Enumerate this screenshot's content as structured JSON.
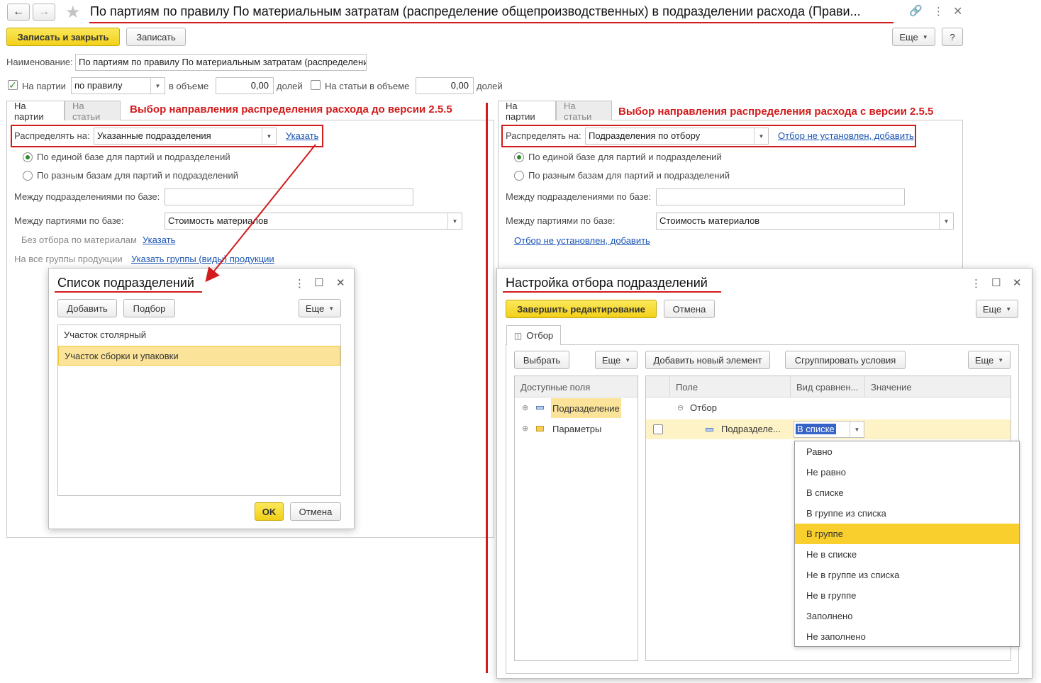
{
  "window": {
    "title": "По партиям по правилу По материальным затратам (распределение общепроизводственных) в подразделении расхода (Прави...",
    "save_close": "Записать и закрыть",
    "save": "Записать",
    "more": "Еще",
    "help": "?"
  },
  "form": {
    "name_label": "Наименование:",
    "name_value": "По партиям по правилу По материальным затратам (распределени",
    "by_batches_label": "На партии",
    "rule_value": "по правилу",
    "volume_label": "в объеме",
    "volume_value": "0,00",
    "shares_label": "долей",
    "by_items_label": "На статьи в объеме",
    "items_volume_value": "0,00",
    "items_shares_label": "долей"
  },
  "left": {
    "tab_batches": "На партии",
    "tab_items": "На статьи",
    "annotation": "Выбор направления распределения расхода до версии 2.5.5",
    "distribute_label": "Распределять на:",
    "distribute_value": "Указанные подразделения",
    "specify_link": "Указать",
    "radio1": "По единой базе для партий и подразделений",
    "radio2": "По разным базам для партий и подразделений",
    "between_depts_label": "Между подразделениями по базе:",
    "between_batches_label": "Между партиями по базе:",
    "between_batches_value": "Стоимость материалов",
    "no_filter_label": "Без отбора по материалам",
    "no_filter_link": "Указать",
    "all_groups_label": "На все группы продукции",
    "all_groups_link": "Указать группы (виды) продукции"
  },
  "dept_dialog": {
    "title": "Список подразделений",
    "add": "Добавить",
    "pick": "Подбор",
    "more": "Еще",
    "items": [
      "Участок столярный",
      "Участок сборки и упаковки"
    ],
    "ok": "OK",
    "cancel": "Отмена"
  },
  "right": {
    "tab_batches": "На партии",
    "tab_items": "На статьи",
    "annotation": "Выбор направления распределения расхода с версии 2.5.5",
    "distribute_label": "Распределять на:",
    "distribute_value": "Подразделения по отбору",
    "filter_link": "Отбор не установлен, добавить",
    "radio1": "По единой базе для партий и подразделений",
    "radio2": "По разным базам для партий и подразделений",
    "between_depts_label": "Между подразделениями по базе:",
    "between_batches_label": "Между партиями по базе:",
    "between_batches_value": "Стоимость материалов",
    "filter_link2": "Отбор не установлен, добавить"
  },
  "filter_dialog": {
    "title": "Настройка отбора подразделений",
    "finish": "Завершить редактирование",
    "cancel": "Отмена",
    "more": "Еще",
    "tab": "Отбор",
    "choose": "Выбрать",
    "more2": "Еще",
    "add_element": "Добавить новый элемент",
    "group_conditions": "Сгруппировать условия",
    "more3": "Еще",
    "available_fields": "Доступные поля",
    "field_dept": "Подразделение",
    "field_params": "Параметры",
    "col_field": "Поле",
    "col_compare": "Вид сравнен...",
    "col_value": "Значение",
    "group_row": "Отбор",
    "cond_field": "Подразделе...",
    "cond_compare": "В списке",
    "options": [
      "Равно",
      "Не равно",
      "В списке",
      "В группе из списка",
      "В группе",
      "Не в списке",
      "Не в группе из списка",
      "Не в группе",
      "Заполнено",
      "Не заполнено"
    ]
  }
}
